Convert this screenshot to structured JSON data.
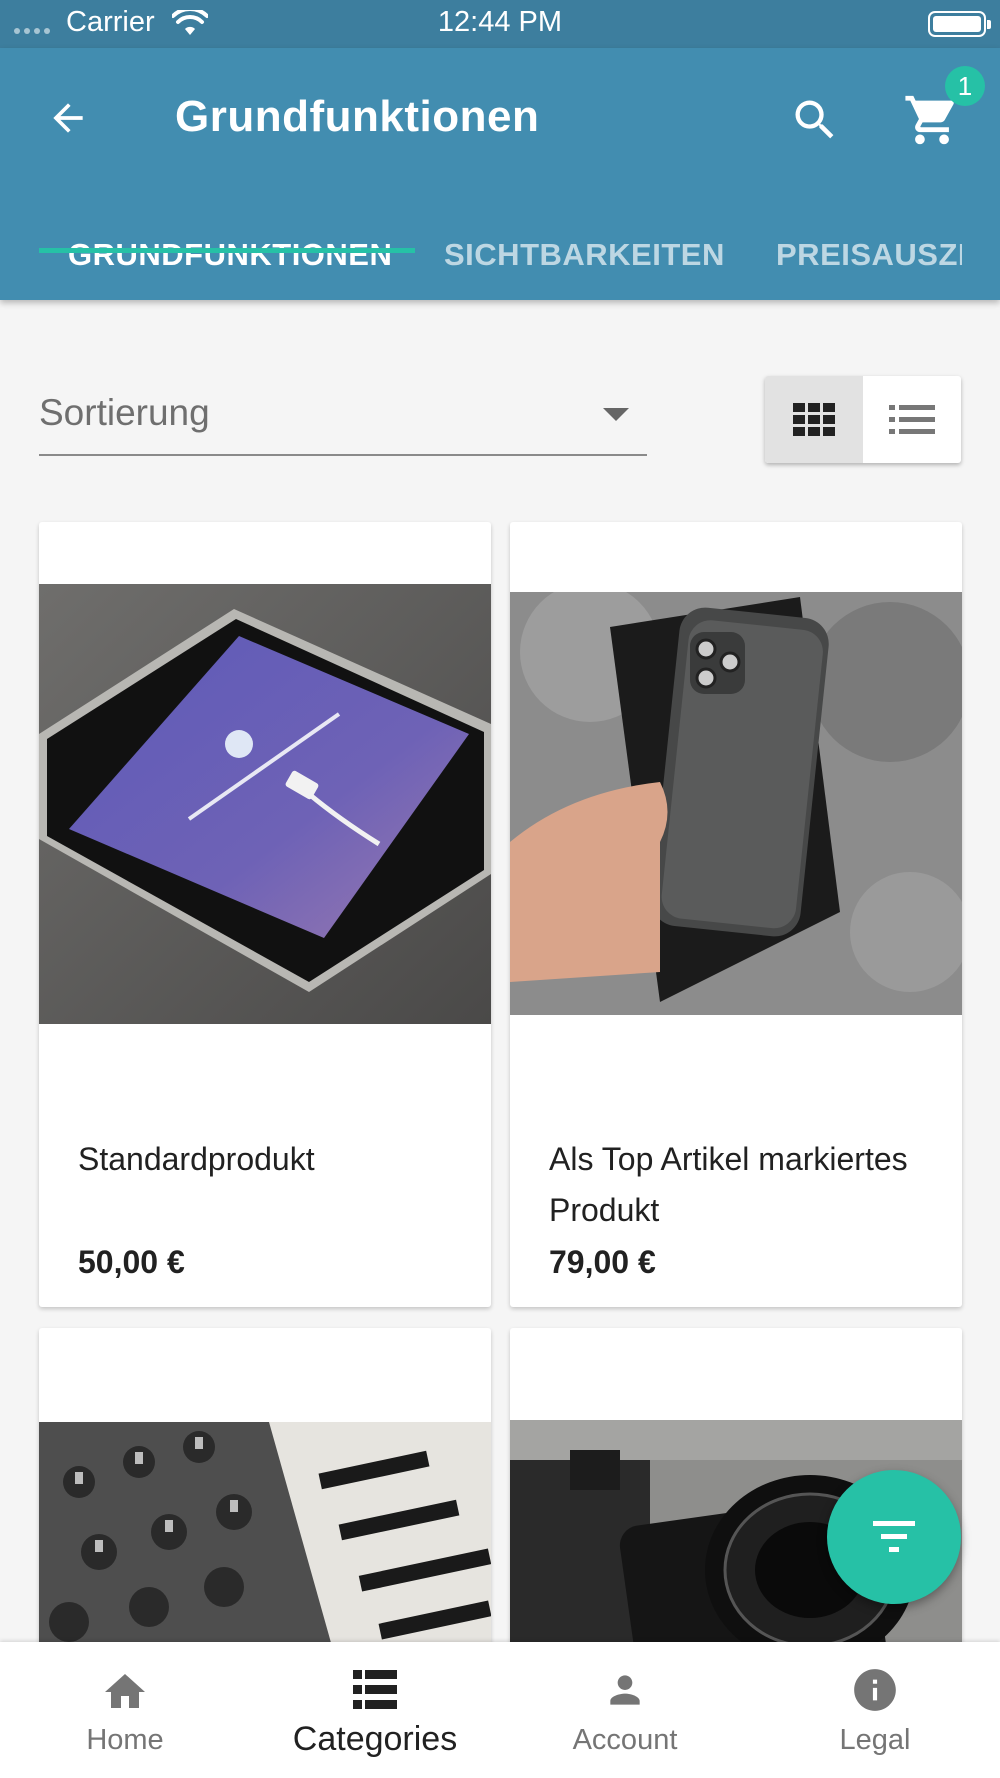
{
  "status_bar": {
    "carrier": "Carrier",
    "time": "12:44 PM"
  },
  "app_bar": {
    "title": "Grundfunktionen",
    "cart_count": "1",
    "icons": {
      "back": "arrow-left-icon",
      "search": "search-icon",
      "cart": "cart-icon"
    }
  },
  "tabs": [
    {
      "label": "GRUNDFUNKTIONEN",
      "active": true
    },
    {
      "label": "SICHTBARKEITEN",
      "active": false
    },
    {
      "label": "PREISAUSZEICHNUNG",
      "active": false
    }
  ],
  "sort": {
    "label": "Sortierung"
  },
  "view_toggle": {
    "selected": "grid",
    "options": [
      "grid",
      "list"
    ]
  },
  "products": [
    {
      "name": "Standardprodukt",
      "price": "50,00 €",
      "image": "tablet-photo"
    },
    {
      "name": "Als Top Artikel markiertes Produkt",
      "price": "79,00 €",
      "image": "smartphone-photo"
    },
    {
      "name": "",
      "price": "",
      "image": "synthesizer-photo"
    },
    {
      "name": "",
      "price": "",
      "image": "camera-photo"
    }
  ],
  "fab": {
    "icon": "filter-icon"
  },
  "bottom_nav": [
    {
      "label": "Home",
      "icon": "home-icon",
      "active": false
    },
    {
      "label": "Categories",
      "icon": "categories-icon",
      "active": true
    },
    {
      "label": "Account",
      "icon": "account-icon",
      "active": false
    },
    {
      "label": "Legal",
      "icon": "info-icon",
      "active": false
    }
  ],
  "colors": {
    "primary": "#428db0",
    "status_bar": "#3d7e9e",
    "accent": "#26c1a6",
    "background": "#f5f5f5"
  }
}
